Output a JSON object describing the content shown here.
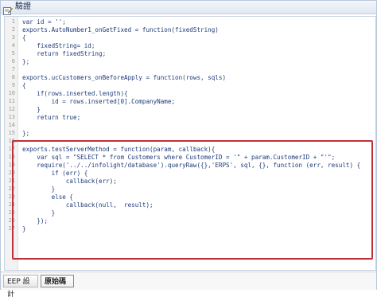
{
  "window": {
    "title": "驗證"
  },
  "icons": {
    "title_icon": "edit-icon"
  },
  "editor": {
    "lines": [
      {
        "n": "1",
        "text": "var id = '';"
      },
      {
        "n": "2",
        "text": "exports.AutoNumber1_onGetFixed = function(fixedString)"
      },
      {
        "n": "3",
        "text": "{"
      },
      {
        "n": "4",
        "text": "    fixedString= id;"
      },
      {
        "n": "5",
        "text": "    return fixedString;"
      },
      {
        "n": "6",
        "text": "};"
      },
      {
        "n": "7",
        "text": ""
      },
      {
        "n": "8",
        "text": "exports.ucCustomers_onBeforeApply = function(rows, sqls)"
      },
      {
        "n": "9",
        "text": "{"
      },
      {
        "n": "10",
        "text": "    if(rows.inserted.length){"
      },
      {
        "n": "11",
        "text": "        id = rows.inserted[0].CompanyName;"
      },
      {
        "n": "12",
        "text": "    }"
      },
      {
        "n": "13",
        "text": "    return true;"
      },
      {
        "n": "14",
        "text": ""
      },
      {
        "n": "15",
        "text": "};"
      },
      {
        "n": "16",
        "text": ""
      },
      {
        "n": "17",
        "text": "exports.testServerMethod = function(param, callback){"
      },
      {
        "n": "18",
        "text": "    var sql = \"SELECT * from Customers where CustomerID = '\" + param.CustomerID + \"'\";"
      },
      {
        "n": "19",
        "text": "    require('../../infolight/database').queryRaw({},'ERPS', sql, {}, function (err, result) {"
      },
      {
        "n": "20",
        "text": "        if (err) {"
      },
      {
        "n": "21",
        "text": "            callback(err);"
      },
      {
        "n": "22",
        "text": "        }"
      },
      {
        "n": "23",
        "text": "        else {"
      },
      {
        "n": "24",
        "text": "            callback(null,  result);"
      },
      {
        "n": "25",
        "text": "        }"
      },
      {
        "n": "26",
        "text": "    });"
      },
      {
        "n": "27",
        "text": "}"
      }
    ]
  },
  "tabs": {
    "eep_design": "EEP 設計",
    "source_code": "原始碼"
  },
  "colors": {
    "highlight_border": "#c0303a",
    "code_text": "#1f3a7a"
  }
}
